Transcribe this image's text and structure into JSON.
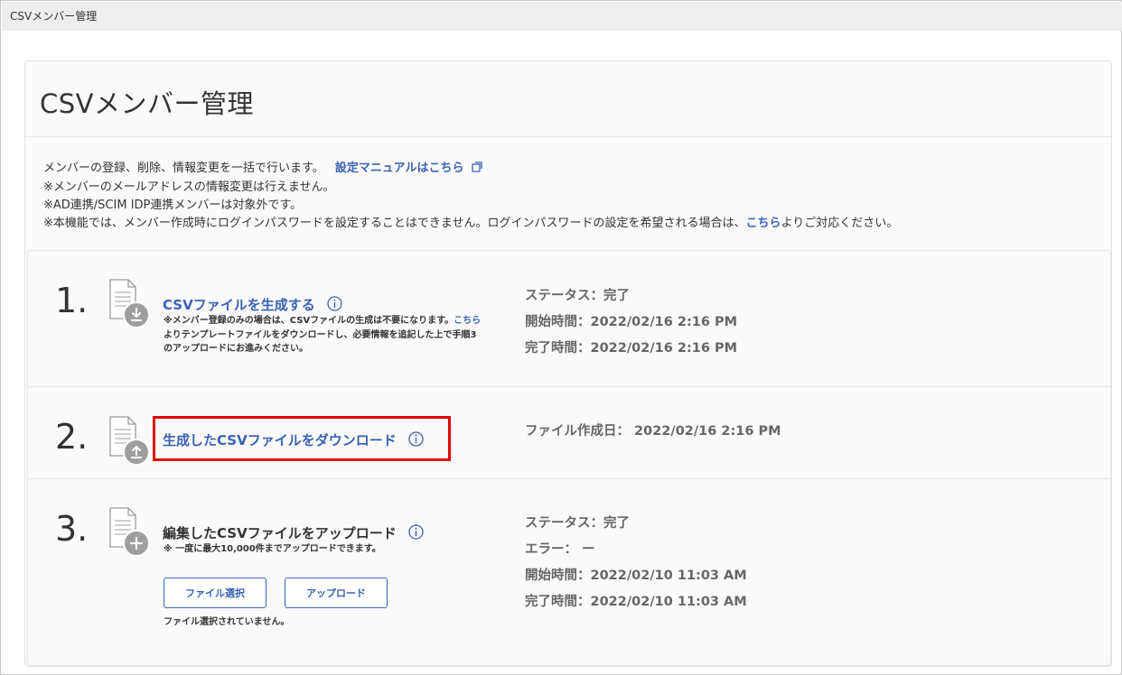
{
  "window": {
    "tab_title": "CSVメンバー管理"
  },
  "page": {
    "title": "CSVメンバー管理"
  },
  "description": {
    "line1_text": "メンバーの登録、削除、情報変更を一括で行います。",
    "line1_link": "設定マニュアルはこちら",
    "line2": "※メンバーのメールアドレスの情報変更は行えません。",
    "line3": "※AD連携/SCIM IDP連携メンバーは対象外です。",
    "line4_pre": "※本機能では、メンバー作成時にログインパスワードを設定することはできません。ログインパスワードの設定を希望される場合は、",
    "line4_link": "こちら",
    "line4_post": "よりご対応ください。"
  },
  "steps": [
    {
      "number": "1.",
      "title": "CSVファイルを生成する",
      "note_line1_pre": "※メンバー登録のみの場合は、CSVファイルの生成は不要になります。",
      "note_line1_link": "こちら",
      "note_line2": "よりテンプレートファイルをダウンロードし、必要情報を追記した上で手順3",
      "note_line3": "のアップロードにお進みください。",
      "status": [
        "ステータス：完了",
        "開始時間：2022/02/16 2:16 PM",
        "完了時間：2022/02/16 2:16 PM"
      ]
    },
    {
      "number": "2.",
      "title": "生成したCSVファイルをダウンロード",
      "status": [
        "ファイル作成日： 2022/02/16 2:16 PM"
      ]
    },
    {
      "number": "3.",
      "title": "編集したCSVファイルをアップロード",
      "note": "※ 一度に最大10,000件までアップロードできます。",
      "select_button": "ファイル選択",
      "upload_button": "アップロード",
      "file_status": "ファイル選択されていません。",
      "status": [
        "ステータス：完了",
        "エラー： ー",
        "開始時間：2022/02/10 11:03 AM",
        "完了時間：2022/02/10 11:03 AM"
      ]
    }
  ],
  "colors": {
    "link": "#3a62b3",
    "highlight": "#e00000",
    "icon_badge": "#9e9e9e"
  },
  "icons": [
    "external-link-icon",
    "info-icon",
    "file-download-icon",
    "file-upload-icon",
    "file-add-icon"
  ]
}
